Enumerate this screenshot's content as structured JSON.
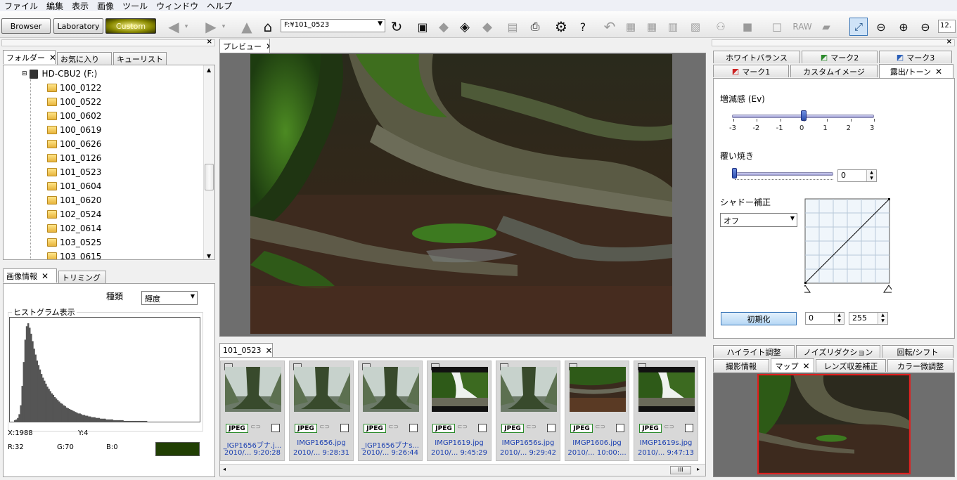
{
  "menu": [
    "ファイル",
    "編集",
    "表示",
    "画像",
    "ツール",
    "ウィンドウ",
    "ヘルプ"
  ],
  "modes": {
    "browser": "Browser",
    "laboratory": "Laboratory",
    "custom": "Custom"
  },
  "path": "F:¥101_0523",
  "zoom_partial": "12.",
  "left_tabs": {
    "folder": "フォルダー",
    "favorites": "お気に入り",
    "cue": "キューリスト"
  },
  "drive": "HD-CBU2 (F:)",
  "folders": [
    "100_0122",
    "100_0522",
    "100_0602",
    "100_0619",
    "100_0626",
    "101_0126",
    "101_0523",
    "101_0604",
    "101_0620",
    "102_0524",
    "102_0614",
    "103_0525",
    "103_0615"
  ],
  "info_tabs": {
    "info": "画像情報",
    "trim": "トリミング"
  },
  "info": {
    "kind_label": "種類",
    "kind_value": "輝度",
    "histogram_label": "ヒストグラム表示",
    "x": "X:1988",
    "y": "Y:4",
    "r": "R:32",
    "g": "G:70",
    "b": "B:0",
    "swatch_color": "#213f04"
  },
  "preview_tab": "プレビュー",
  "browser_tab": "101_0523",
  "thumbnails": [
    {
      "name": "_IGP1656ブナ.j...",
      "date": "2010/... 9:20:28",
      "type": "JPEG",
      "kind": "fog"
    },
    {
      "name": "IMGP1656.jpg",
      "date": "2010/... 9:28:31",
      "type": "JPEG",
      "kind": "fog"
    },
    {
      "name": "_IGP1656ブナs...",
      "date": "2010/... 9:26:44",
      "type": "JPEG",
      "kind": "fog"
    },
    {
      "name": "IMGP1619.jpg",
      "date": "2010/... 9:45:29",
      "type": "JPEG",
      "kind": "trunk"
    },
    {
      "name": "IMGP1656s.jpg",
      "date": "2010/... 9:29:42",
      "type": "JPEG",
      "kind": "fog"
    },
    {
      "name": "IMGP1606.jpg",
      "date": "2010/... 10:00:...",
      "type": "JPEG",
      "kind": "roots"
    },
    {
      "name": "IMGP1619s.jpg",
      "date": "2010/... 9:47:13",
      "type": "JPEG",
      "kind": "trunk"
    }
  ],
  "right_tabs_row1": [
    "ホワイトバランス",
    "マーク2",
    "マーク3"
  ],
  "right_tabs_row2": [
    "マーク1",
    "カスタムイメージ",
    "露出/トーン"
  ],
  "exposure": {
    "ev_label": "増減感 (Ev)",
    "ev_ticks": [
      "-3",
      "-2",
      "-1",
      "0",
      "1",
      "2",
      "3"
    ],
    "ev_value": 0,
    "burn_label": "覆い焼き",
    "burn_value": "0",
    "shadow_label": "シャドー補正",
    "shadow_value": "オフ",
    "reset_label": "初期化",
    "curve_min": "0",
    "curve_max": "255"
  },
  "bottom_tabs_row1": [
    "ハイライト調整",
    "ノイズリダクション",
    "回転/シフト"
  ],
  "bottom_tabs_row2": [
    "撮影情報",
    "マップ",
    "レンズ収差補正",
    "カラー微調整"
  ],
  "histogram": [
    2,
    3,
    5,
    10,
    22,
    48,
    80,
    110,
    128,
    132,
    126,
    118,
    108,
    98,
    90,
    82,
    76,
    70,
    64,
    59,
    55,
    51,
    47,
    44,
    41,
    38,
    36,
    33,
    31,
    29,
    27,
    25,
    24,
    22,
    21,
    19,
    18,
    17,
    16,
    15,
    14,
    13,
    12,
    11,
    11,
    10,
    9,
    9,
    8,
    8,
    7,
    7,
    6,
    6,
    6,
    5,
    5,
    5,
    4,
    4,
    4,
    4,
    3,
    3,
    3,
    3,
    3,
    2,
    2,
    2,
    2,
    2,
    2,
    2,
    1,
    1,
    1,
    1,
    1,
    1,
    1,
    1,
    1,
    1,
    1,
    1,
    1,
    1,
    1,
    1
  ]
}
